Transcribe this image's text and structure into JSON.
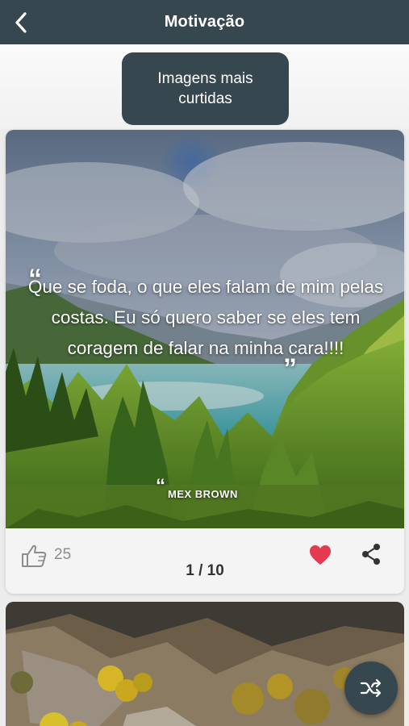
{
  "navbar": {
    "title": "Motivação",
    "back_icon": "chevron-left-icon"
  },
  "top_button": {
    "label": "Imagens mais curtidas"
  },
  "card": {
    "quote": "Que se foda, o que eles falam de mim pelas costas. Eu só quero saber se eles tem coragem de falar na minha cara!!!!",
    "author": "MEX BROWN",
    "likes": "25",
    "page_indicator": "1 / 10",
    "like_icon": "thumbs-up-icon",
    "favorite_icon": "heart-icon",
    "share_icon": "share-icon"
  },
  "fab": {
    "icon": "shuffle-icon"
  },
  "colors": {
    "primary": "#37474f",
    "favorite": "#e53950",
    "background": "#ececec"
  }
}
